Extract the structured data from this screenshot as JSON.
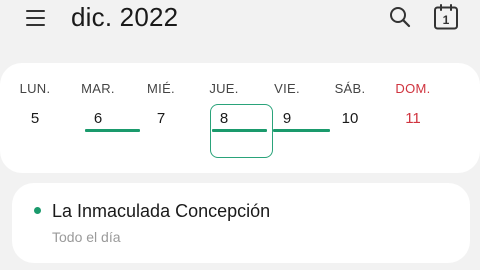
{
  "header": {
    "title": "dic. 2022",
    "today_icon_number": "1",
    "icons": [
      "menu-icon",
      "search-icon",
      "calendar-today-icon"
    ]
  },
  "week": {
    "days": [
      {
        "name": "LUN.",
        "num": "5"
      },
      {
        "name": "MAR.",
        "num": "6",
        "has_event": true
      },
      {
        "name": "MIÉ.",
        "num": "7"
      },
      {
        "name": "JUE.",
        "num": "8",
        "has_event": true,
        "selected": true
      },
      {
        "name": "VIE.",
        "num": "9",
        "has_event": true
      },
      {
        "name": "SÁB.",
        "num": "10"
      },
      {
        "name": "DOM.",
        "num": "11",
        "sunday": true
      }
    ]
  },
  "event": {
    "title": "La Inmaculada Concepción",
    "subtitle": "Todo el día"
  },
  "colors": {
    "accent": "#1a9a6c",
    "sunday": "#d0343f",
    "background": "#f2f2f2",
    "card": "#ffffff"
  }
}
